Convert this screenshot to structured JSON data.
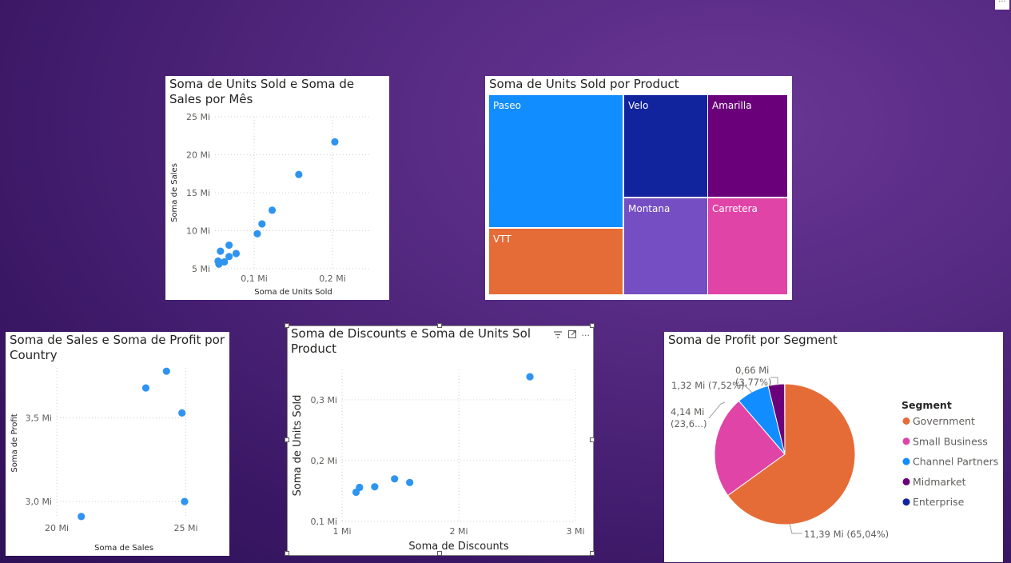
{
  "report": {
    "more_label": "···"
  },
  "charts": {
    "units_sales_month": {
      "title": "Soma de Units Sold e Soma de Sales por Mês",
      "title_line1": "Soma de Units Sold e Soma de",
      "title_line2": "Sales por Mês",
      "color": "#2f94f0"
    },
    "units_by_product": {
      "title": "Soma de Units Sold por Product"
    },
    "sales_profit_country": {
      "title_line1": "Soma de Sales e Soma de Profit por",
      "title_line2": "Country",
      "color": "#2f94f0"
    },
    "discounts_units_product": {
      "title_line1": "Soma de Discounts e Soma de Units Sol",
      "title_line2": "Product",
      "color": "#2f94f0",
      "header_icons": [
        "filter-icon",
        "focus-mode-icon",
        "more-options-icon"
      ],
      "more_label": "···"
    },
    "profit_by_segment": {
      "title": "Soma de Profit por Segment"
    }
  },
  "chart_data": [
    {
      "type": "scatter",
      "xlabel": "Soma de Units Sold",
      "ylabel": "Soma de Sales",
      "xlim": [
        0.05,
        0.25
      ],
      "ylim": [
        5,
        25
      ],
      "x_ticks": [
        0.1,
        0.2
      ],
      "x_tick_labels": [
        "0,1 Mi",
        "0,2 Mi"
      ],
      "y_ticks": [
        5,
        10,
        15,
        20,
        25
      ],
      "y_tick_labels": [
        "5 Mi",
        "10 Mi",
        "15 Mi",
        "20 Mi",
        "25 Mi"
      ],
      "points": [
        {
          "x": 0.203,
          "y": 21.7
        },
        {
          "x": 0.157,
          "y": 17.4
        },
        {
          "x": 0.123,
          "y": 12.7
        },
        {
          "x": 0.11,
          "y": 10.9
        },
        {
          "x": 0.104,
          "y": 9.6
        },
        {
          "x": 0.068,
          "y": 8.1
        },
        {
          "x": 0.077,
          "y": 7.0
        },
        {
          "x": 0.057,
          "y": 7.3
        },
        {
          "x": 0.068,
          "y": 6.6
        },
        {
          "x": 0.062,
          "y": 5.9
        },
        {
          "x": 0.054,
          "y": 6.0
        },
        {
          "x": 0.055,
          "y": 5.6
        }
      ],
      "grid": true
    },
    {
      "type": "treemap",
      "items": [
        {
          "label": "Paseo",
          "color": "#118dff"
        },
        {
          "label": "VTT",
          "color": "#e66c37"
        },
        {
          "label": "Velo",
          "color": "#12239e"
        },
        {
          "label": "Amarilla",
          "color": "#6b007b"
        },
        {
          "label": "Montana",
          "color": "#744ec2"
        },
        {
          "label": "Carretera",
          "color": "#e044a7"
        }
      ]
    },
    {
      "type": "scatter",
      "xlabel": "Soma de Sales",
      "ylabel": "Soma de Profit",
      "xlim": [
        20,
        25.2
      ],
      "ylim": [
        2.9,
        3.8
      ],
      "x_ticks": [
        20,
        25
      ],
      "x_tick_labels": [
        "20 Mi",
        "25 Mi"
      ],
      "y_ticks": [
        3.0,
        3.5
      ],
      "y_tick_labels": [
        "3,0 Mi",
        "3,5 Mi"
      ],
      "points": [
        {
          "x": 24.25,
          "y": 3.78
        },
        {
          "x": 23.45,
          "y": 3.68
        },
        {
          "x": 24.85,
          "y": 3.53
        },
        {
          "x": 24.95,
          "y": 3.0
        },
        {
          "x": 20.95,
          "y": 2.91
        }
      ],
      "grid": true
    },
    {
      "type": "scatter",
      "xlabel": "Soma de Discounts",
      "ylabel": "Soma de Units Sold",
      "xlim": [
        1.0,
        3.0
      ],
      "ylim": [
        0.1,
        0.35
      ],
      "x_ticks": [
        1,
        2,
        3
      ],
      "x_tick_labels": [
        "1 Mi",
        "2 Mi",
        "3 Mi"
      ],
      "y_ticks": [
        0.1,
        0.2,
        0.3
      ],
      "y_tick_labels": [
        "0,1 Mi",
        "0,2 Mi",
        "0,3 Mi"
      ],
      "points": [
        {
          "x": 2.61,
          "y": 0.338
        },
        {
          "x": 1.45,
          "y": 0.17
        },
        {
          "x": 1.58,
          "y": 0.164
        },
        {
          "x": 1.28,
          "y": 0.157
        },
        {
          "x": 1.15,
          "y": 0.156
        },
        {
          "x": 1.12,
          "y": 0.148
        }
      ],
      "grid": true
    },
    {
      "type": "pie",
      "legend_title": "Segment",
      "legend_position": "right",
      "slices": [
        {
          "name": "Government",
          "value": 65.04,
          "label": "11,39 Mi (65,04%)",
          "color": "#e66c37"
        },
        {
          "name": "Small Business",
          "value": 23.63,
          "label_line1": "4,14 Mi",
          "label_line2": "(23,6...)",
          "color": "#e044a7"
        },
        {
          "name": "Channel Partners",
          "value": 7.52,
          "label": "1,32 Mi (7,52%)",
          "color": "#118dff"
        },
        {
          "name": "Midmarket",
          "value": 3.77,
          "label_line1": "0,66 Mi",
          "label_line2": "(3,77%)",
          "color": "#6b007b"
        },
        {
          "name": "Enterprise",
          "value": 0.04,
          "color": "#12239e"
        }
      ]
    }
  ]
}
